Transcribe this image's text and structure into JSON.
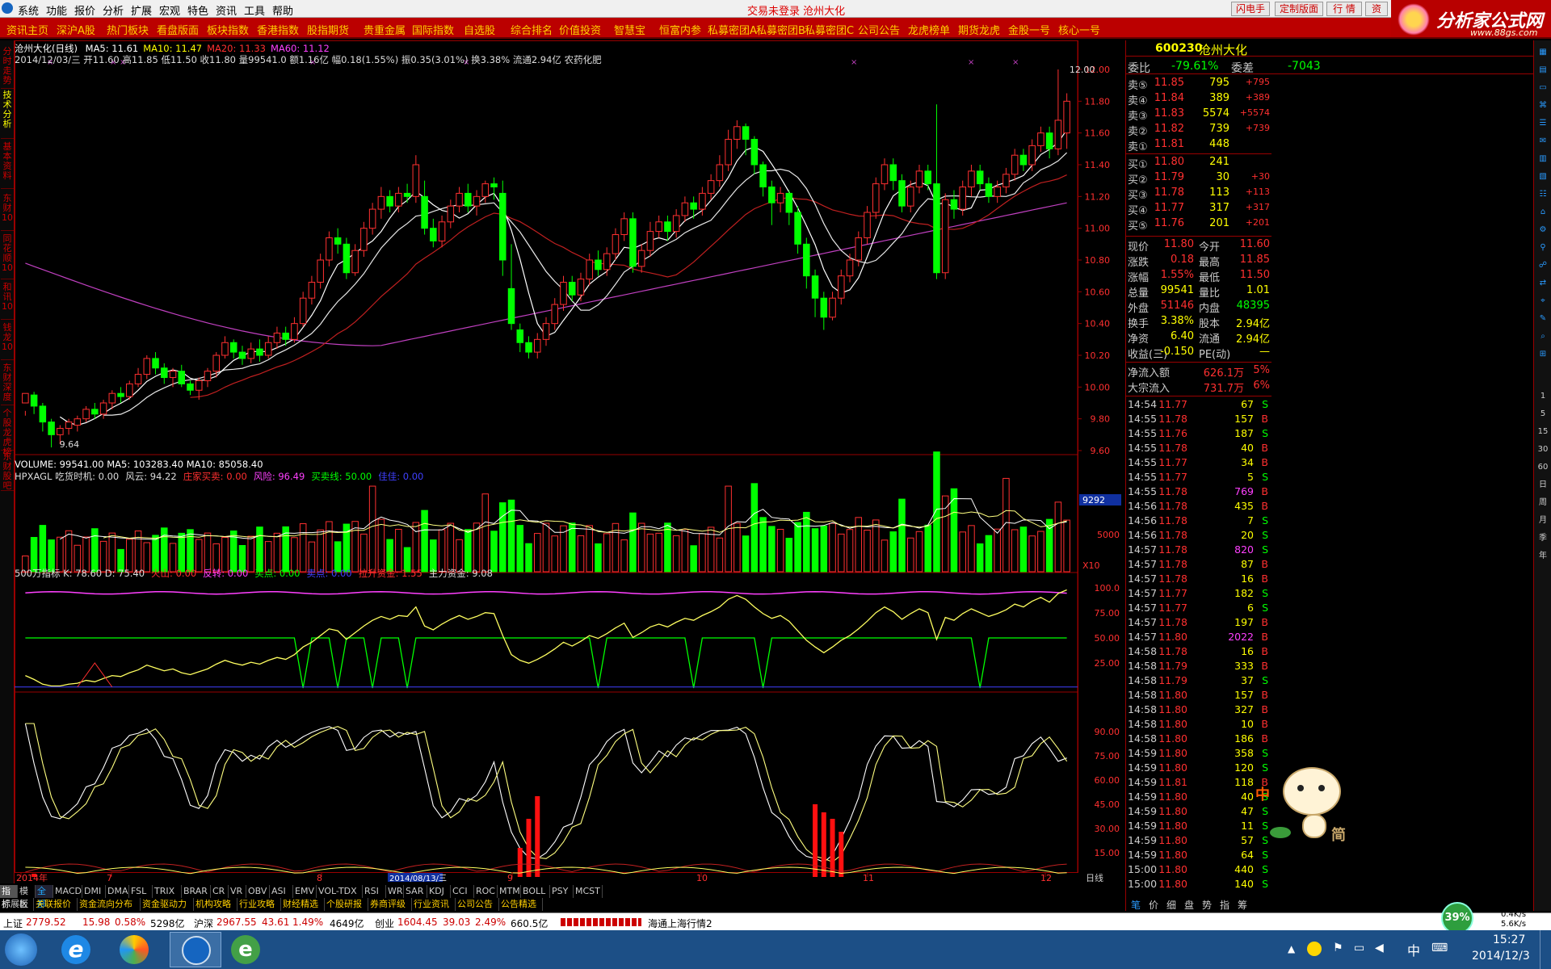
{
  "menubar": {
    "items": [
      "系统",
      "功能",
      "报价",
      "分析",
      "扩展",
      "宏观",
      "特色",
      "资讯",
      "工具",
      "帮助"
    ],
    "title": "交易未登录 沧州大化",
    "buttons": [
      "闪电手",
      "定制版面",
      "行 情",
      "资"
    ]
  },
  "logo": {
    "text": "分析家公式网",
    "url": "www.88gs.com"
  },
  "navbar": [
    "资讯主页",
    "深沪A股",
    "热门板块",
    "看盘版面",
    "板块指数",
    "香港指数",
    "股指期货",
    "贵重金属",
    "国际指数",
    "自选股",
    "综合排名",
    "价值投资",
    "智慧宝",
    "恒富内参",
    "私募密团A",
    "私募密团B",
    "私募密团C",
    "公司公告",
    "龙虎榜单",
    "期货龙虎",
    "金股一号",
    "核心一号"
  ],
  "left_tabs": [
    "分时走势",
    "技术分析",
    "基本资料",
    "东财10",
    "同花顺10",
    "和讯10",
    "钱龙10",
    "东财深度",
    "个股龙虎榜",
    "东财股吧"
  ],
  "main_panel": {
    "title": "沧州大化(日线)",
    "ma_labels": [
      {
        "text": "MA5: 11.61",
        "color": "#ffffff"
      },
      {
        "text": "MA10: 11.47",
        "color": "#ffff00"
      },
      {
        "text": "MA20: 11.33",
        "color": "#ff3030"
      },
      {
        "text": "MA60: 11.12",
        "color": "#ff40ff"
      }
    ],
    "info_line": "2014/12/03/三 开11.60 高11.85 低11.50 收11.80 量99541.0 额1.16亿 幅0.18(1.55%) 振0.35(3.01%) 换3.38% 流通2.94亿 农药化肥",
    "y_ticks": [
      "12.00",
      "11.80",
      "11.60",
      "11.40",
      "11.20",
      "11.00",
      "10.80",
      "10.60",
      "10.40",
      "10.20",
      "10.00",
      "9.80",
      "9.60"
    ],
    "max_label": "12.00",
    "min_label": "9.64"
  },
  "volume_panel": {
    "label": "VOLUME: 99541.00  MA5: 103283.40  MA10: 85058.40",
    "y_ticks": [
      "9292",
      "5000",
      "X10"
    ]
  },
  "hpxagl_panel": {
    "labels": [
      {
        "text": "HPXAGL 吃货时机: 0.00",
        "color": "#dddddd"
      },
      {
        "text": "风云: 94.22",
        "color": "#dddddd"
      },
      {
        "text": "庄家买卖: 0.00",
        "color": "#ff3030"
      },
      {
        "text": "风险: 96.49",
        "color": "#ff40ff"
      },
      {
        "text": "买卖线: 50.00",
        "color": "#00ff00"
      },
      {
        "text": "佳佳: 0.00",
        "color": "#4040ff"
      }
    ],
    "y_ticks": [
      "100.0",
      "75.00",
      "50.00",
      "25.00"
    ]
  },
  "five_million_panel": {
    "labels": [
      {
        "text": "500万指标 K: 78.60 D: 75.40",
        "color": "#dddddd"
      },
      {
        "text": "火山: 0.00",
        "color": "#ff3030"
      },
      {
        "text": "反转: 0.00",
        "color": "#ff40ff"
      },
      {
        "text": "买点: 0.00",
        "color": "#00ff00"
      },
      {
        "text": "卖点: 0.00",
        "color": "#4040ff"
      },
      {
        "text": "拉升资金: 1.55",
        "color": "#ff3030"
      },
      {
        "text": "主力资金: 9.08",
        "color": "#dddddd"
      }
    ],
    "y_ticks": [
      "90.00",
      "75.00",
      "60.00",
      "45.00",
      "30.00",
      "15.00"
    ]
  },
  "time_axis": {
    "labels": [
      "2014年",
      "7",
      "8",
      "9",
      "10",
      "11",
      "12"
    ],
    "cursor_date": "2014/08/13/三",
    "period": "日线"
  },
  "stock_header": {
    "code": "600230",
    "name": "沧州大化"
  },
  "bid_ratio": {
    "label1": "委比",
    "value1": "-79.61%",
    "label2": "委差",
    "value2": "-7043"
  },
  "asks": [
    {
      "label": "卖⑤",
      "price": "11.85",
      "vol": "795",
      "chg": "+795"
    },
    {
      "label": "卖④",
      "price": "11.84",
      "vol": "389",
      "chg": "+389"
    },
    {
      "label": "卖③",
      "price": "11.83",
      "vol": "5574",
      "chg": "+5574"
    },
    {
      "label": "卖②",
      "price": "11.82",
      "vol": "739",
      "chg": "+739"
    },
    {
      "label": "卖①",
      "price": "11.81",
      "vol": "448",
      "chg": ""
    }
  ],
  "bids": [
    {
      "label": "买①",
      "price": "11.80",
      "vol": "241",
      "chg": ""
    },
    {
      "label": "买②",
      "price": "11.79",
      "vol": "30",
      "chg": "+30"
    },
    {
      "label": "买③",
      "price": "11.78",
      "vol": "113",
      "chg": "+113"
    },
    {
      "label": "买④",
      "price": "11.77",
      "vol": "317",
      "chg": "+317"
    },
    {
      "label": "买⑤",
      "price": "11.76",
      "vol": "201",
      "chg": "+201"
    }
  ],
  "stats": [
    {
      "l1": "现价",
      "v1": "11.80",
      "c1": "#ff3030",
      "l2": "今开",
      "v2": "11.60",
      "c2": "#ff3030"
    },
    {
      "l1": "涨跌",
      "v1": "0.18",
      "c1": "#ff3030",
      "l2": "最高",
      "v2": "11.85",
      "c2": "#ff3030"
    },
    {
      "l1": "涨幅",
      "v1": "1.55%",
      "c1": "#ff3030",
      "l2": "最低",
      "v2": "11.50",
      "c2": "#ff3030"
    },
    {
      "l1": "总量",
      "v1": "99541",
      "c1": "#ffff00",
      "l2": "量比",
      "v2": "1.01",
      "c2": "#ffff00"
    },
    {
      "l1": "外盘",
      "v1": "51146",
      "c1": "#ff3030",
      "l2": "内盘",
      "v2": "48395",
      "c2": "#00ff00"
    },
    {
      "l1": "换手",
      "v1": "3.38%",
      "c1": "#ffff00",
      "l2": "股本",
      "v2": "2.94亿",
      "c2": "#ffff00"
    },
    {
      "l1": "净资",
      "v1": "6.40",
      "c1": "#ffff00",
      "l2": "流通",
      "v2": "2.94亿",
      "c2": "#ffff00"
    },
    {
      "l1": "收益(三)",
      "v1": "-0.150",
      "c1": "#ffff00",
      "l2": "PE(动)",
      "v2": "—",
      "c2": "#ffff00"
    }
  ],
  "flows": [
    {
      "label": "净流入额",
      "value": "626.1万",
      "pct": "5%"
    },
    {
      "label": "大宗流入",
      "value": "731.7万",
      "pct": "6%"
    }
  ],
  "ticks": [
    {
      "t": "14:54",
      "p": "11.77",
      "v": "67",
      "s": "S"
    },
    {
      "t": "14:55",
      "p": "11.78",
      "v": "157",
      "s": "B"
    },
    {
      "t": "14:55",
      "p": "11.76",
      "v": "187",
      "s": "S"
    },
    {
      "t": "14:55",
      "p": "11.78",
      "v": "40",
      "s": "B"
    },
    {
      "t": "14:55",
      "p": "11.77",
      "v": "34",
      "s": "B"
    },
    {
      "t": "14:55",
      "p": "11.77",
      "v": "5",
      "s": "S"
    },
    {
      "t": "14:55",
      "p": "11.78",
      "v": "769",
      "s": "B"
    },
    {
      "t": "14:56",
      "p": "11.78",
      "v": "435",
      "s": "B"
    },
    {
      "t": "14:56",
      "p": "11.78",
      "v": "7",
      "s": "S"
    },
    {
      "t": "14:56",
      "p": "11.78",
      "v": "20",
      "s": "S"
    },
    {
      "t": "14:57",
      "p": "11.78",
      "v": "820",
      "s": "S"
    },
    {
      "t": "14:57",
      "p": "11.78",
      "v": "87",
      "s": "B"
    },
    {
      "t": "14:57",
      "p": "11.78",
      "v": "16",
      "s": "B"
    },
    {
      "t": "14:57",
      "p": "11.77",
      "v": "182",
      "s": "S"
    },
    {
      "t": "14:57",
      "p": "11.77",
      "v": "6",
      "s": "S"
    },
    {
      "t": "14:57",
      "p": "11.78",
      "v": "197",
      "s": "B"
    },
    {
      "t": "14:57",
      "p": "11.80",
      "v": "2022",
      "s": "B"
    },
    {
      "t": "14:58",
      "p": "11.78",
      "v": "16",
      "s": "B"
    },
    {
      "t": "14:58",
      "p": "11.79",
      "v": "333",
      "s": "B"
    },
    {
      "t": "14:58",
      "p": "11.79",
      "v": "37",
      "s": "S"
    },
    {
      "t": "14:58",
      "p": "11.80",
      "v": "157",
      "s": "B"
    },
    {
      "t": "14:58",
      "p": "11.80",
      "v": "327",
      "s": "B"
    },
    {
      "t": "14:58",
      "p": "11.80",
      "v": "10",
      "s": "B"
    },
    {
      "t": "14:58",
      "p": "11.80",
      "v": "186",
      "s": "B"
    },
    {
      "t": "14:59",
      "p": "11.80",
      "v": "358",
      "s": "S"
    },
    {
      "t": "14:59",
      "p": "11.80",
      "v": "120",
      "s": "S"
    },
    {
      "t": "14:59",
      "p": "11.81",
      "v": "118",
      "s": "B"
    },
    {
      "t": "14:59",
      "p": "11.80",
      "v": "40",
      "s": "S"
    },
    {
      "t": "14:59",
      "p": "11.80",
      "v": "47",
      "s": "S"
    },
    {
      "t": "14:59",
      "p": "11.80",
      "v": "11",
      "s": "S"
    },
    {
      "t": "14:59",
      "p": "11.80",
      "v": "57",
      "s": "S"
    },
    {
      "t": "14:59",
      "p": "11.80",
      "v": "64",
      "s": "S"
    },
    {
      "t": "15:00",
      "p": "11.80",
      "v": "440",
      "s": "S"
    },
    {
      "t": "15:00",
      "p": "11.80",
      "v": "140",
      "s": "S"
    }
  ],
  "right_toolbar": [
    "1",
    "5",
    "15",
    "30",
    "60",
    "日",
    "周",
    "月",
    "季",
    "年"
  ],
  "bottom_tabs_row1": [
    "指标",
    "模板",
    "全部",
    "MACD",
    "DMI",
    "DMA",
    "FSL",
    "TRIX",
    "BRAR",
    "CR",
    "VR",
    "OBV",
    "ASI",
    "EMV",
    "VOL-TDX",
    "RSI",
    "WR",
    "SAR",
    "KDJ",
    "CCI",
    "ROC",
    "MTM",
    "BOLL",
    "PSY",
    "MCST"
  ],
  "bottom_tabs_row2": [
    "扩展区",
    "关联报价",
    "资金流向分布",
    "资金驱动力",
    "机构攻略",
    "行业攻略",
    "财经精选",
    "个股研报",
    "券商评级",
    "行业资讯",
    "公司公告",
    "公告精选"
  ],
  "right_bottom_tabs": [
    "笔",
    "价",
    "细",
    "盘",
    "势",
    "指",
    "筹"
  ],
  "status": {
    "sh_label": "上证",
    "sh_val": "2779.52",
    "sh_chg": "15.98",
    "sh_pct": "0.58%",
    "sh_amt": "5298亿",
    "hs_label": "沪深",
    "hs_val": "2967.55",
    "hs_chg": "43.61",
    "hs_pct": "1.49%",
    "hs_amt": "4649亿",
    "cy_label": "创业",
    "cy_val": "1604.45",
    "cy_chg": "39.03",
    "cy_pct": "2.49%",
    "cy_amt": "660.5亿",
    "server": "海通上海行情2",
    "net_pct": "39%",
    "up": "0.4K/s",
    "down": "5.6K/s"
  },
  "taskbar": {
    "time": "15:27",
    "date": "2014/12/3",
    "ime": "中"
  },
  "mascot_labels": [
    "中",
    "简"
  ],
  "chart_data": {
    "type": "candlestick",
    "candles": [
      [
        9.9,
        9.96,
        9.85,
        9.82
      ],
      [
        9.95,
        9.88,
        9.97,
        9.83
      ],
      [
        9.88,
        9.78,
        9.9,
        9.72
      ],
      [
        9.78,
        9.7,
        9.8,
        9.62
      ],
      [
        9.7,
        9.74,
        9.76,
        9.64
      ],
      [
        9.74,
        9.78,
        9.8,
        9.7
      ],
      [
        9.76,
        9.8,
        9.82,
        9.72
      ],
      [
        9.8,
        9.86,
        9.88,
        9.78
      ],
      [
        9.86,
        9.83,
        9.9,
        9.8
      ],
      [
        9.83,
        9.9,
        9.92,
        9.8
      ],
      [
        9.9,
        9.96,
        9.98,
        9.86
      ],
      [
        9.96,
        9.94,
        10.0,
        9.9
      ],
      [
        9.94,
        10.02,
        10.04,
        9.92
      ],
      [
        10.02,
        10.08,
        10.12,
        10.0
      ],
      [
        10.08,
        10.18,
        10.2,
        10.05
      ],
      [
        10.18,
        10.12,
        10.22,
        10.08
      ],
      [
        10.12,
        10.06,
        10.15,
        10.02
      ],
      [
        10.06,
        10.1,
        10.12,
        10.0
      ],
      [
        10.1,
        10.02,
        10.14,
        10.0
      ],
      [
        10.02,
        9.98,
        10.04,
        9.95
      ],
      [
        9.98,
        10.04,
        10.06,
        9.92
      ],
      [
        10.04,
        10.1,
        10.12,
        10.0
      ],
      [
        10.1,
        10.2,
        10.22,
        10.06
      ],
      [
        10.2,
        10.28,
        10.32,
        10.18
      ],
      [
        10.28,
        10.22,
        10.3,
        10.18
      ],
      [
        10.22,
        10.18,
        10.26,
        10.14
      ],
      [
        10.18,
        10.24,
        10.28,
        10.15
      ],
      [
        10.24,
        10.2,
        10.3,
        10.16
      ],
      [
        10.2,
        10.28,
        10.32,
        10.18
      ],
      [
        10.28,
        10.34,
        10.38,
        10.24
      ],
      [
        10.34,
        10.3,
        10.38,
        10.26
      ],
      [
        10.3,
        10.4,
        10.44,
        10.28
      ],
      [
        10.4,
        10.56,
        10.6,
        10.38
      ],
      [
        10.56,
        10.66,
        10.7,
        10.52
      ],
      [
        10.66,
        10.8,
        10.84,
        10.62
      ],
      [
        10.8,
        10.94,
        10.98,
        10.76
      ],
      [
        10.94,
        10.9,
        11.0,
        10.84
      ],
      [
        10.9,
        10.72,
        10.94,
        10.68
      ],
      [
        10.72,
        10.86,
        10.9,
        10.7
      ],
      [
        10.86,
        11.0,
        11.04,
        10.82
      ],
      [
        11.0,
        11.12,
        11.16,
        10.96
      ],
      [
        11.12,
        11.2,
        11.26,
        11.06
      ],
      [
        11.2,
        11.14,
        11.24,
        11.1
      ],
      [
        11.14,
        11.22,
        11.26,
        11.1
      ],
      [
        11.22,
        11.2,
        11.28,
        11.16
      ],
      [
        11.2,
        11.4,
        11.46,
        11.16
      ],
      [
        11.2,
        11.0,
        11.3,
        10.96
      ],
      [
        11.0,
        10.92,
        11.06,
        10.88
      ],
      [
        10.92,
        11.04,
        11.08,
        10.88
      ],
      [
        11.04,
        11.14,
        11.18,
        11.0
      ],
      [
        11.14,
        11.22,
        11.26,
        11.1
      ],
      [
        11.22,
        11.14,
        11.28,
        11.1
      ],
      [
        11.14,
        11.2,
        11.24,
        11.08
      ],
      [
        11.2,
        11.28,
        11.3,
        11.16
      ],
      [
        11.28,
        11.26,
        11.32,
        11.18
      ],
      [
        11.22,
        10.8,
        11.3,
        10.7
      ],
      [
        10.62,
        10.4,
        10.9,
        10.36
      ],
      [
        10.36,
        10.28,
        10.4,
        10.22
      ],
      [
        10.28,
        10.22,
        10.32,
        10.18
      ],
      [
        10.22,
        10.3,
        10.34,
        10.18
      ],
      [
        10.3,
        10.4,
        10.44,
        10.26
      ],
      [
        10.4,
        10.52,
        10.56,
        10.36
      ],
      [
        10.52,
        10.66,
        10.7,
        10.48
      ],
      [
        10.66,
        10.58,
        10.7,
        10.54
      ],
      [
        10.58,
        10.68,
        10.72,
        10.54
      ],
      [
        10.68,
        10.8,
        10.84,
        10.64
      ],
      [
        10.8,
        10.74,
        10.86,
        10.7
      ],
      [
        10.74,
        10.84,
        10.88,
        10.7
      ],
      [
        10.84,
        10.96,
        11.0,
        10.8
      ],
      [
        10.96,
        11.06,
        11.1,
        10.92
      ],
      [
        11.06,
        10.76,
        11.1,
        10.72
      ],
      [
        10.76,
        10.86,
        10.9,
        10.72
      ],
      [
        10.86,
        10.98,
        11.04,
        10.82
      ],
      [
        10.98,
        11.04,
        11.08,
        10.94
      ],
      [
        11.04,
        10.98,
        11.08,
        10.92
      ],
      [
        10.98,
        11.08,
        11.12,
        10.94
      ],
      [
        11.08,
        11.16,
        11.2,
        11.04
      ],
      [
        11.16,
        11.12,
        11.2,
        11.06
      ],
      [
        11.12,
        11.22,
        11.26,
        11.08
      ],
      [
        11.22,
        11.3,
        11.34,
        11.18
      ],
      [
        11.3,
        11.4,
        11.46,
        11.26
      ],
      [
        11.4,
        11.56,
        11.62,
        11.36
      ],
      [
        11.56,
        11.64,
        11.68,
        11.5
      ],
      [
        11.64,
        11.56,
        11.66,
        11.46
      ],
      [
        11.56,
        11.4,
        11.58,
        11.34
      ],
      [
        11.4,
        11.26,
        11.42,
        11.2
      ],
      [
        11.26,
        11.16,
        11.3,
        11.02
      ],
      [
        11.16,
        11.22,
        11.26,
        11.1
      ],
      [
        11.22,
        11.1,
        11.24,
        11.02
      ],
      [
        11.1,
        10.9,
        11.14,
        10.84
      ],
      [
        10.9,
        10.7,
        10.94,
        10.62
      ],
      [
        10.7,
        10.56,
        10.74,
        10.44
      ],
      [
        10.56,
        10.44,
        10.6,
        10.36
      ],
      [
        10.44,
        10.56,
        10.6,
        10.42
      ],
      [
        10.56,
        10.7,
        10.74,
        10.52
      ],
      [
        10.7,
        10.8,
        10.84,
        10.66
      ],
      [
        10.8,
        10.94,
        10.98,
        10.76
      ],
      [
        10.94,
        11.1,
        11.14,
        10.9
      ],
      [
        11.1,
        11.28,
        11.32,
        11.06
      ],
      [
        11.28,
        11.4,
        11.44,
        11.24
      ],
      [
        11.4,
        11.3,
        11.44,
        11.24
      ],
      [
        11.3,
        11.14,
        11.34,
        11.1
      ],
      [
        11.14,
        11.26,
        11.3,
        11.1
      ],
      [
        11.26,
        11.36,
        11.4,
        11.22
      ],
      [
        11.36,
        11.28,
        11.4,
        11.24
      ],
      [
        11.28,
        10.72,
        11.78,
        10.68
      ],
      [
        10.72,
        11.18,
        11.22,
        10.68
      ],
      [
        11.18,
        11.12,
        11.24,
        11.06
      ],
      [
        11.12,
        11.26,
        11.3,
        11.08
      ],
      [
        11.26,
        11.36,
        11.4,
        11.2
      ],
      [
        11.36,
        11.28,
        11.4,
        11.24
      ],
      [
        11.28,
        11.2,
        11.32,
        11.16
      ],
      [
        11.2,
        11.26,
        11.3,
        11.16
      ],
      [
        11.26,
        11.34,
        11.38,
        11.22
      ],
      [
        11.34,
        11.46,
        11.5,
        11.3
      ],
      [
        11.46,
        11.4,
        11.5,
        11.36
      ],
      [
        11.4,
        11.52,
        11.56,
        11.36
      ],
      [
        11.52,
        11.6,
        11.64,
        11.48
      ],
      [
        11.6,
        11.5,
        11.64,
        11.44
      ],
      [
        11.5,
        11.68,
        12.0,
        11.46
      ],
      [
        11.6,
        11.8,
        11.85,
        11.5
      ]
    ],
    "volume_ma": {
      "ma5": 103283.4,
      "ma10": 85058.4
    },
    "ylim": [
      9.6,
      12.0
    ],
    "x_months": [
      "2014年",
      "7",
      "8",
      "9",
      "10",
      "11",
      "12"
    ]
  }
}
